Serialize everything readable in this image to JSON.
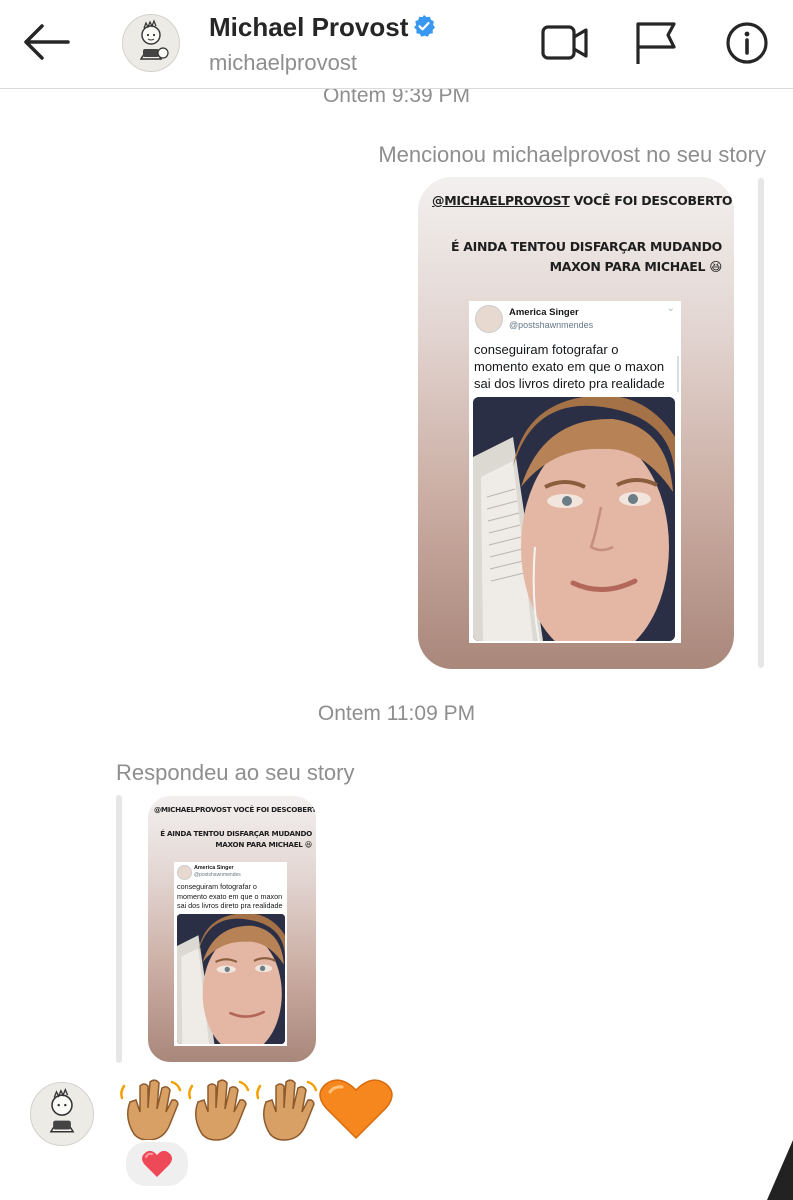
{
  "header": {
    "username": "Michael Provost",
    "handle": "michaelprovost",
    "verified": true,
    "icons": [
      "back-arrow-icon",
      "video-call-icon",
      "flag-icon",
      "info-icon"
    ]
  },
  "thread": {
    "timestamp_1": "Ontem 9:39 PM",
    "mention_label": "Mencionou michaelprovost no seu story",
    "timestamp_2": "Ontem 11:09 PM",
    "reply_label": "Respondeu ao seu story",
    "story": {
      "mention": "@MICHAELPROVOST",
      "mention_rest": " VOCÊ FOI DESCOBERTO",
      "caption_line1": "É AINDA TENTOU DISFARÇAR MUDANDO",
      "caption_line2": "MAXON PARA MICHAEL",
      "caption_emoji": "😆",
      "tweet": {
        "name": "America Singer",
        "handle": "@postshawnmendes",
        "text": "conseguiram fotografar o momento exato em que o maxon sai dos livros direto pra realidade"
      }
    },
    "reply_message": {
      "emoji_text": "👋👋👋🧡",
      "reaction": "❤️"
    }
  },
  "colors": {
    "text_primary": "#262626",
    "text_secondary": "#8e8e8e",
    "verified_blue": "#3897f0",
    "heart_red": "#ed4956",
    "heart_orange": "#f6871f"
  }
}
